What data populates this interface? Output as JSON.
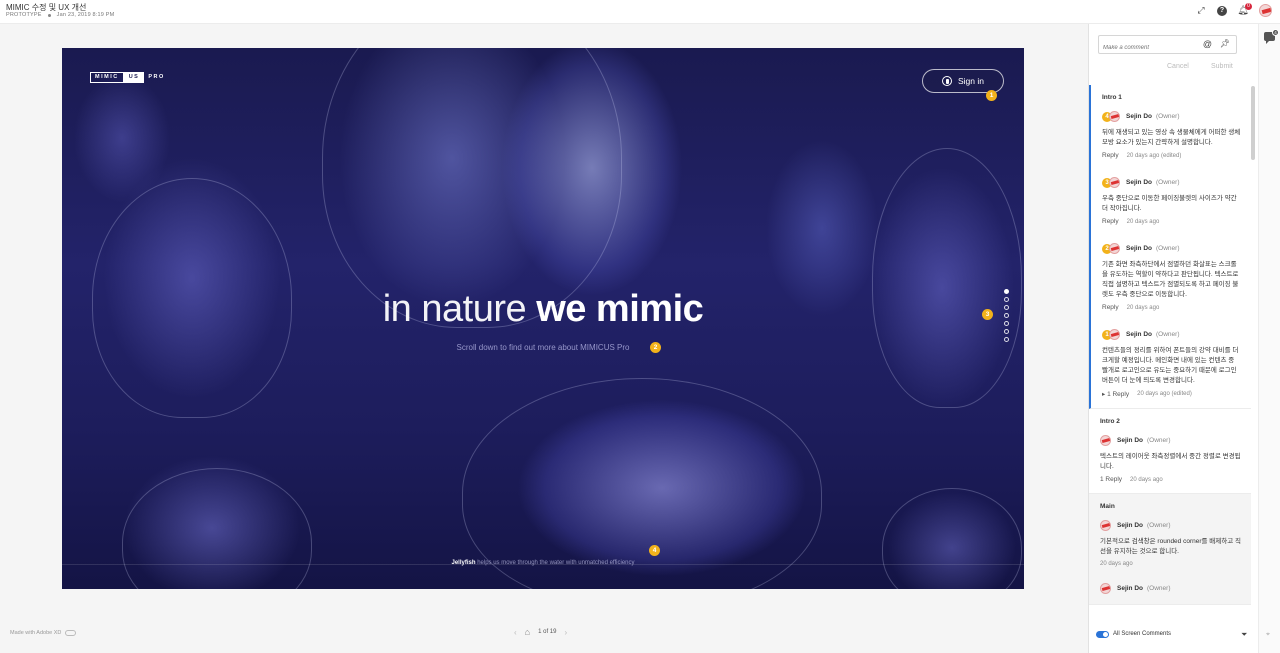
{
  "header": {
    "title": "MIMIC 수정 및 UX 개선",
    "type_label": "PROTOTYPE",
    "date": "Jan 23, 2019 8:19 PM",
    "notification_count": "0",
    "icons": [
      "expand-icon",
      "help-icon",
      "bell-icon",
      "user-avatar"
    ]
  },
  "artboard": {
    "logo": [
      "MIMIC",
      "US",
      "PRO"
    ],
    "signin_label": "Sign in",
    "hero_light": "in nature",
    "hero_bold": "we mimic",
    "subline": "Scroll down to find out more about MIMICUS Pro",
    "footer_bold": "Jellyfish",
    "footer_rest": "helps us move through the water with unmatched efficiency",
    "hotspots": [
      "1",
      "2",
      "3",
      "4"
    ],
    "page_dots_count": 7
  },
  "footer": {
    "made_with": "Made with Adobe XD",
    "page_indicator": "1 of 19"
  },
  "comments_panel": {
    "input_placeholder": "Make a comment",
    "cancel_label": "Cancel",
    "submit_label": "Submit",
    "all_screen_label": "All Screen Comments",
    "rail_badge": "4",
    "sections": [
      {
        "title": "Intro 1",
        "comments": [
          {
            "badge": "4",
            "name": "Sejin Do",
            "role": "(Owner)",
            "body": "뒤에 재생되고 있는 영상 속 생물체에게 어떠한 생체모방 요소가 있는지 간략하게 설명합니다.",
            "reply": "Reply",
            "time": "20 days ago (edited)"
          },
          {
            "badge": "3",
            "name": "Sejin Do",
            "role": "(Owner)",
            "body": "우측 중단으로 이동한 페이징불렛의 사이즈가 약간 더 작아집니다.",
            "reply": "Reply",
            "time": "20 days ago"
          },
          {
            "badge": "2",
            "name": "Sejin Do",
            "role": "(Owner)",
            "body": "기존 화면 좌측하단에서 점멸하던 화살표는 스크롤을 유도하는 역할이 약하다고 판단됩니다. 텍스트로 직접 설명하고 텍스트가 점멸되도록 하고 페이징 불렛도 우측 중단으로 이동합니다.",
            "reply": "Reply",
            "time": "20 days ago"
          },
          {
            "badge": "1",
            "name": "Sejin Do",
            "role": "(Owner)",
            "body": "컨텐츠들의 정리를 위하여 폰트들의 강약 대비를 더 크게할 예정입니다. 메인화면 내에 있는 컨텐츠 중 빨개로 로고인으로 유도는 중요하기 때문에 로그인 버튼이 더 눈에 띄도록 변경합니다.",
            "reply": "▸ 1 Reply",
            "time": "20 days ago (edited)"
          }
        ]
      },
      {
        "title": "Intro 2",
        "comments": [
          {
            "badge": "",
            "name": "Sejin Do",
            "role": "(Owner)",
            "body": "텍스트의 레이어웃 좌측정렬에서 중간 정렬로 변경됩니다.",
            "reply": "1 Reply",
            "time": "20 days ago"
          }
        ]
      },
      {
        "title": "Main",
        "comments": [
          {
            "badge": "",
            "name": "Sejin Do",
            "role": "(Owner)",
            "body": "기본적으로 검색창은 rounded corner를 배제하고 직선을 유지하는 것으로 합니다.",
            "reply": "",
            "time": "20 days ago"
          },
          {
            "badge": "",
            "name": "Sejin Do",
            "role": "(Owner)",
            "body": "",
            "reply": "",
            "time": ""
          }
        ]
      }
    ]
  },
  "colors": {
    "accent": "#2a73d7",
    "hotspot": "#f2b21b",
    "notification": "#d7263d"
  }
}
